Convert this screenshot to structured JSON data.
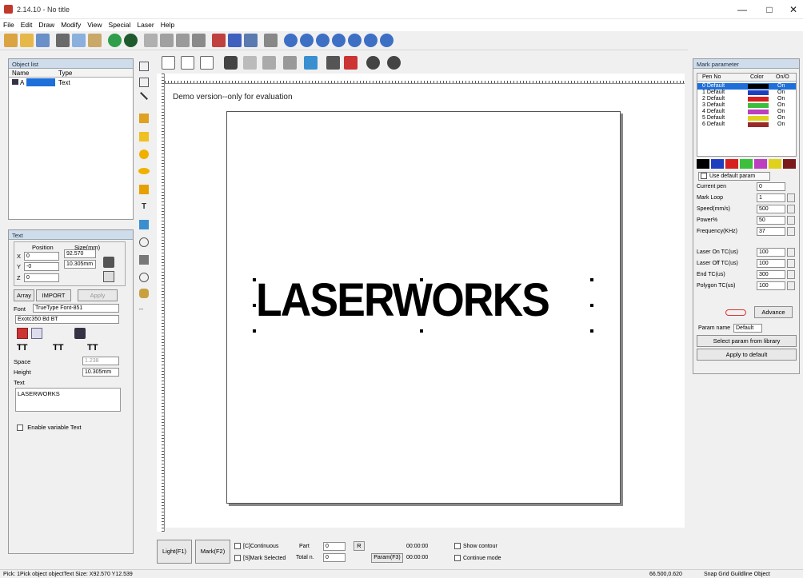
{
  "title": "2.14.10 - No title",
  "window_controls": {
    "minimize": "—",
    "maximize": "□",
    "close": "✕"
  },
  "menu": [
    "File",
    "Edit",
    "Draw",
    "Modify",
    "View",
    "Special",
    "Laser",
    "Help"
  ],
  "object_list": {
    "title": "Object list",
    "col_name": "Name",
    "col_type": "Type",
    "rows": [
      {
        "name": "A",
        "type": "Text"
      }
    ]
  },
  "text_panel": {
    "title": "Text",
    "position_label": "Position",
    "size_label": "Size(mm)",
    "x_label": "X",
    "x_value": "0",
    "y_label": "Y",
    "y_value": "-0",
    "z_label": "Z",
    "z_value": "0",
    "width_value": "92.570",
    "height_value": "10.305mm",
    "array_button": "Array",
    "import_button": "IMPORT",
    "apply_button": "Apply",
    "font_label": "Font",
    "font_type": "TrueType Font-851",
    "font_name": "Exotc350 Bd BT",
    "space_label": "Space",
    "space_value": "1.238",
    "height_label": "Height",
    "text_label": "Text",
    "text_value": "LASERWORKS",
    "variable_text_label": "Enable variable Text"
  },
  "canvas": {
    "demo_notice": "Demo version--only for evaluation",
    "object_text": "LASERWORKS"
  },
  "mark_params": {
    "title": "Mark parameter",
    "col_pen": "Pen No",
    "col_color": "Color",
    "col_onoff": "On/O",
    "pens": [
      {
        "name": "0 Default",
        "color": "#000000",
        "state": "On"
      },
      {
        "name": "1 Default",
        "color": "#1d3fbf",
        "state": "On"
      },
      {
        "name": "2 Default",
        "color": "#d62020",
        "state": "On"
      },
      {
        "name": "3 Default",
        "color": "#3cbf3c",
        "state": "On"
      },
      {
        "name": "4 Default",
        "color": "#bb3fbf",
        "state": "On"
      },
      {
        "name": "5 Default",
        "color": "#e0d21c",
        "state": "On"
      },
      {
        "name": "6 Default",
        "color": "#9a2a2a",
        "state": "On"
      }
    ],
    "palette": [
      "#000000",
      "#1d3fbf",
      "#d62020",
      "#3cbf3c",
      "#bb3fbf",
      "#e0d21c",
      "#7a1a1a"
    ],
    "use_default_param": "Use default param",
    "current_pen_label": "Current pen",
    "current_pen_value": "0",
    "mark_loop_label": "Mark Loop",
    "mark_loop_value": "1",
    "speed_label": "Speed(mm/s)",
    "speed_value": "500",
    "power_label": "Power%",
    "power_value": "50",
    "frequency_label": "Frequency(KHz)",
    "frequency_value": "37",
    "laser_on_label": "Laser On TC(us)",
    "laser_on_value": "100",
    "laser_off_label": "Laser Off TC(us)",
    "laser_off_value": "100",
    "end_tc_label": "End TC(us)",
    "end_tc_value": "300",
    "polygon_tc_label": "Polygon TC(us)",
    "polygon_tc_value": "100",
    "advance_button": "Advance",
    "param_name_label": "Param name",
    "param_name_value": "Default",
    "select_library_button": "Select param from library",
    "apply_default_button": "Apply to default"
  },
  "bottom_bar": {
    "light_button": "Light(F1)",
    "mark_button": "Mark(F2)",
    "continuous_label": "[C]Continuous",
    "mark_selected_label": "[S]Mark Selected",
    "part_label": "Part",
    "part_value": "0",
    "r_button": "R",
    "total_label": "Total n.",
    "total_value": "0",
    "time1": "00:00:00",
    "time2": "00:00:00",
    "param_button": "Param(F3)",
    "show_contour_label": "Show contour",
    "continue_mode_label": "Continue mode"
  },
  "status_bar": {
    "left": "Pick: 1Pick object objectText Size: X92.570 Y12.539",
    "coords": "66.500,0.620",
    "right": "Snap Grid Guildline Object"
  }
}
